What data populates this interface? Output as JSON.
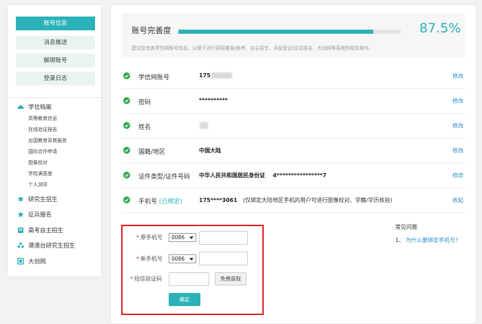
{
  "account_menu": [
    "账号信息",
    "消息推送",
    "解绑账号",
    "登录日志"
  ],
  "sidebar": {
    "xueji_label": "学信档案",
    "xueji_sub": [
      "高等教育信息",
      "在线验证报告",
      "出国教育背景服务",
      "国际合作申请",
      "图像校对",
      "学校满意度",
      "个人测评"
    ],
    "items": [
      "研究生招生",
      "征兵报名",
      "高考自主招生",
      "港澳台研究生招生",
      "大创网"
    ]
  },
  "completeness": {
    "title": "账号完善度",
    "percent_text": "87.5%",
    "percent_value": 87.5,
    "hint": "建议您完善学信网账号信息，以便于进行研招推免/统考、自主招生、兵役登记/应征报名、大创网等系统的相关操作。"
  },
  "rows": [
    {
      "label": "学信网账号",
      "value": "175",
      "action": "修改"
    },
    {
      "label": "密码",
      "value": "**********",
      "action": "修改"
    },
    {
      "label": "姓名",
      "value": "",
      "action": "修改"
    },
    {
      "label": "国籍/地区",
      "value": "中国大陆",
      "action": "修改"
    },
    {
      "label": "证件类型/证件号码",
      "value": "中华人民共和国居民身份证",
      "value2": "4****************7",
      "action": "修改"
    },
    {
      "label": "手机号",
      "label_tag": "(已绑定)",
      "value": "175****3061",
      "note": "(仅绑定大陆地区手机的用户可进行图像校对、学籍/学历核验)",
      "action": "收起"
    }
  ],
  "form": {
    "required_mark": "*",
    "original_phone_label": "原手机号",
    "new_phone_label": "新手机号",
    "sms_code_label": "短信验证码",
    "country_code": "0086",
    "get_code_button": "免费获取",
    "confirm_button": "确定"
  },
  "faq": {
    "title": "常见问题",
    "item_num": "1、",
    "item_text": "为什么要绑定手机号?"
  },
  "colors": {
    "accent": "#2bb2b8",
    "link": "#2b8fc7",
    "check": "#2fa84f",
    "alert_border": "#e0191b"
  }
}
